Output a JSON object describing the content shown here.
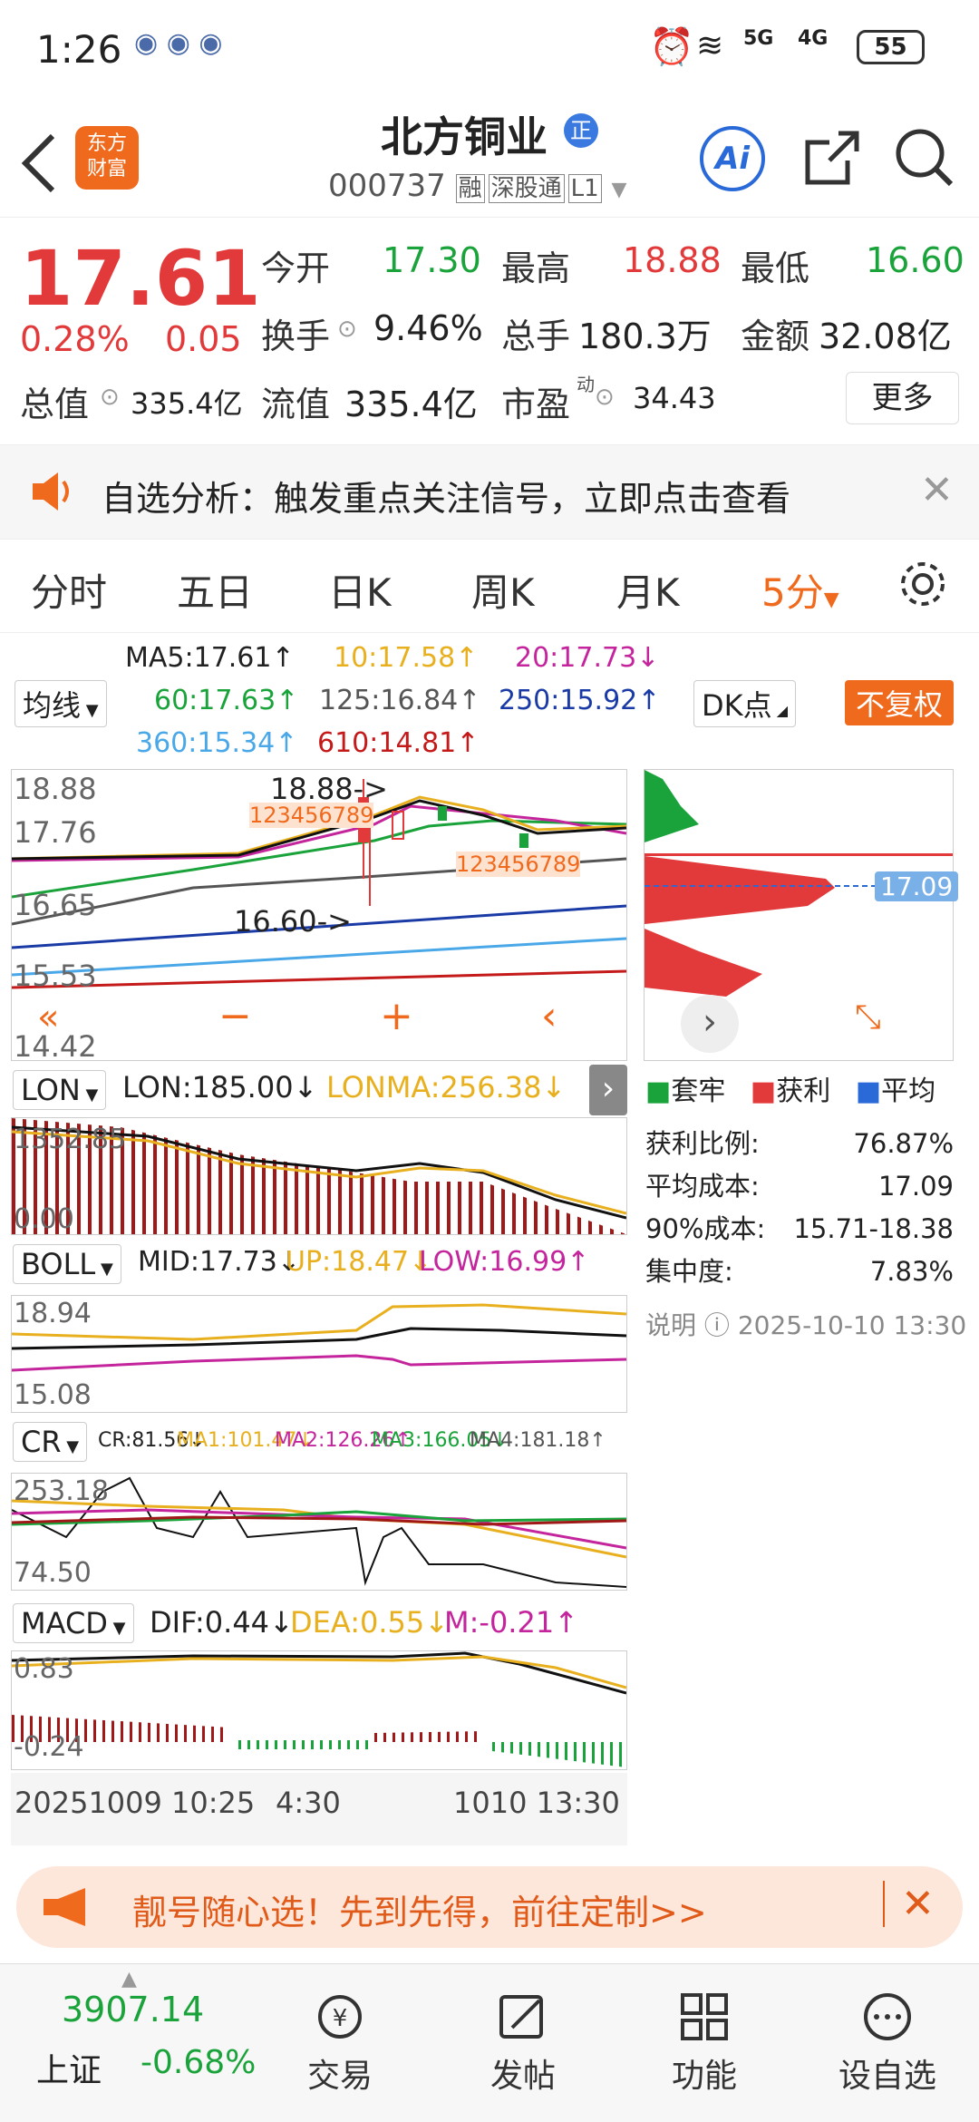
{
  "status_bar": {
    "time": "1:26",
    "battery": "55",
    "signal1": "5G",
    "signal2": "4G"
  },
  "header": {
    "title": "北方铜业",
    "badge": "正",
    "code": "000737",
    "tags": [
      "融",
      "深股通",
      "L1"
    ],
    "logo_line1": "东方",
    "logo_line2": "财富",
    "ai_label": "Ai"
  },
  "quote": {
    "price": "17.61",
    "change_pct": "0.28%",
    "change": "0.05",
    "open_label": "今开",
    "open": "17.30",
    "high_label": "最高",
    "high": "18.88",
    "low_label": "最低",
    "low": "16.60",
    "turnover_label": "换手",
    "turnover": "9.46%",
    "volume_label": "总手",
    "volume": "180.3万",
    "amount_label": "金额",
    "amount": "32.08亿",
    "mktcap_label": "总值",
    "mktcap": "335.4亿",
    "float_label": "流值",
    "float": "335.4亿",
    "pe_label": "市盈",
    "pe_sup": "动",
    "pe": "34.43",
    "more_label": "更多"
  },
  "banner": {
    "text": "自选分析：触发重点关注信号，立即点击查看"
  },
  "tabs": [
    "分时",
    "五日",
    "日K",
    "周K",
    "月K",
    "5分"
  ],
  "ma": {
    "selector": "均线",
    "ma5": "MA5:17.61↑",
    "ma10": "10:17.58↑",
    "ma20": "20:17.73↓",
    "ma60": "60:17.63↑",
    "ma125": "125:16.84↑",
    "ma250": "250:15.92↑",
    "ma360": "360:15.34↑",
    "ma610": "610:14.81↑",
    "dk_label": "DK点",
    "fq_label": "不复权"
  },
  "main_chart": {
    "y_labels": [
      "18.88",
      "17.76",
      "16.65",
      "15.53",
      "14.42"
    ],
    "high_note": "18.88->",
    "low_note": "16.60->",
    "seq1": "123456789",
    "seq2": "123456789"
  },
  "chip": {
    "avg_price": "17.09",
    "legend": [
      "套牢",
      "获利",
      "平均"
    ],
    "rows": [
      {
        "label": "获利比例:",
        "value": "76.87%"
      },
      {
        "label": "平均成本:",
        "value": "17.09"
      },
      {
        "label": "90%成本:",
        "value": "15.71-18.38"
      },
      {
        "label": "集中度:",
        "value": "7.83%"
      }
    ],
    "note_label": "说明",
    "note_time": "2025-10-10 13:30"
  },
  "lon": {
    "selector": "LON",
    "lon": "LON:185.00↓",
    "lonma": "LONMA:256.38↓",
    "y_top": "1352.85",
    "y_bottom": "0.00"
  },
  "boll": {
    "selector": "BOLL",
    "mid": "MID:17.73↓",
    "up": "UP:18.47↓",
    "low": "LOW:16.99↑",
    "y_top": "18.94",
    "y_bottom": "15.08"
  },
  "cr": {
    "selector": "CR",
    "cr": "CR:81.56↓",
    "ma1": "MA1:101.47↓",
    "ma2": "MA2:126.26↑",
    "ma3": "MA3:166.05↓",
    "ma4": "MA4:181.18↑",
    "y_top": "253.18",
    "y_bottom": "74.50"
  },
  "macd": {
    "selector": "MACD",
    "dif": "DIF:0.44↓",
    "dea": "DEA:0.55↓",
    "m": "M:-0.21↑",
    "y_top": "0.83",
    "y_bottom": "-0.24"
  },
  "time_axis": {
    "left": "20251009 10:25",
    "mid": "4:30",
    "right": "1010 13:30"
  },
  "promo": {
    "text": "靓号随心选！先到先得，前往定制>>"
  },
  "bottom_nav": {
    "index_value": "3907.14",
    "index_name": "上证",
    "index_change": "-0.68%",
    "items": [
      "交易",
      "发帖",
      "功能",
      "设自选"
    ]
  },
  "colors": {
    "up": "#e23a3a",
    "down": "#1aa33a",
    "accent": "#f06a1e"
  }
}
